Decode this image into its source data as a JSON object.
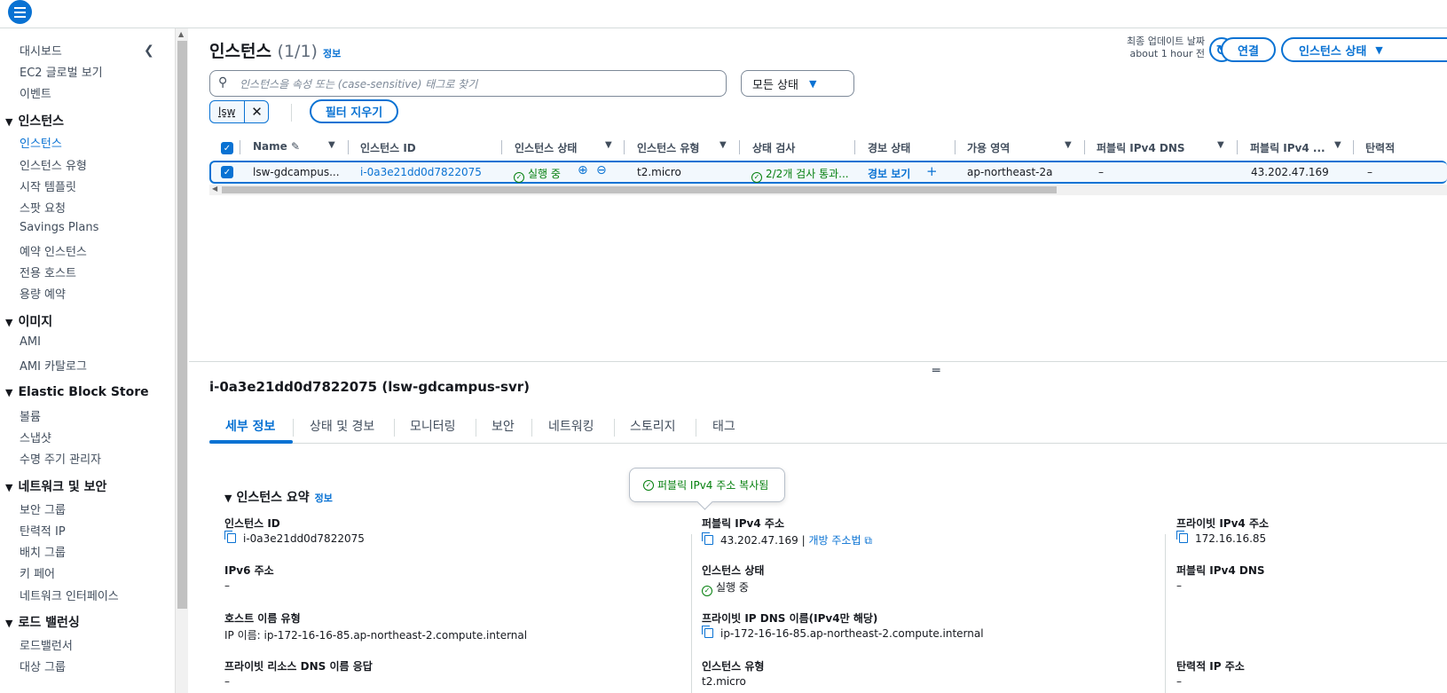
{
  "sidebar": {
    "items_top": [
      "대시보드",
      "EC2 글로벌 보기",
      "이벤트"
    ],
    "sections": [
      {
        "title": "인스턴스",
        "items": [
          "인스턴스",
          "인스턴스 유형",
          "시작 템플릿",
          "스팟 요청",
          "Savings Plans",
          "예약 인스턴스",
          "전용 호스트",
          "용량 예약"
        ]
      },
      {
        "title": "이미지",
        "items": [
          "AMI",
          "AMI 카탈로그"
        ]
      },
      {
        "title": "Elastic Block Store",
        "items": [
          "볼륨",
          "스냅샷",
          "수명 주기 관리자"
        ]
      },
      {
        "title": "네트워크 및 보안",
        "items": [
          "보안 그룹",
          "탄력적 IP",
          "배치 그룹",
          "키 페어",
          "네트워크 인터페이스"
        ]
      },
      {
        "title": "로드 밸런싱",
        "items": [
          "로드밸런서",
          "대상 그룹"
        ]
      }
    ],
    "active_item": "인스턴스"
  },
  "header": {
    "title": "인스턴스",
    "count": "(1/1)",
    "info": "정보",
    "updated_label": "최종 업데이트 날짜",
    "updated_value": "about 1 hour 전",
    "connect_label": "연결",
    "state_label": "인스턴스 상태"
  },
  "search": {
    "placeholder": "인스턴스을 속성 또는 (case-sensitive) 태그로 찾기"
  },
  "state_filter": {
    "selected": "모든 상태"
  },
  "token": {
    "label": "lsw"
  },
  "clear_filters_label": "필터 지우기",
  "table": {
    "columns": [
      "Name",
      "인스턴스 ID",
      "인스턴스 상태",
      "인스턴스 유형",
      "상태 검사",
      "경보 상태",
      "가용 영역",
      "퍼블릭 IPv4 DNS",
      "퍼블릭 IPv4 ...",
      "탄력적"
    ],
    "row": {
      "name": "lsw-gdcampus...",
      "instance_id": "i-0a3e21dd0d7822075",
      "state": "실행 중",
      "type": "t2.micro",
      "status_check": "2/2개 검사 통과...",
      "alarm": "경보 보기",
      "az": "ap-northeast-2a",
      "public_dns": "–",
      "public_ip": "43.202.47.169",
      "elastic": "–"
    }
  },
  "detail": {
    "title": "i-0a3e21dd0d7822075 (lsw-gdcampus-svr)",
    "tabs": [
      "세부 정보",
      "상태 및 경보",
      "모니터링",
      "보안",
      "네트워킹",
      "스토리지",
      "태그"
    ],
    "section_title": "인스턴스 요약",
    "section_info": "정보",
    "popover": "퍼블릭 IPv4 주소 복사됨",
    "fields": {
      "instance_id_label": "인스턴스 ID",
      "instance_id_value": "i-0a3e21dd0d7822075",
      "public_ipv4_label_partial": "퍼블릭 IPv4 주소",
      "public_ipv4_value": "43.202.47.169",
      "public_ipv4_sep": " | ",
      "open_address_link": "개방 주소법",
      "private_ipv4_label": "프라이빗 IPv4 주소",
      "private_ipv4_value": "172.16.16.85",
      "ipv6_label": "IPv6 주소",
      "ipv6_value": "–",
      "state_label": "인스턴스 상태",
      "state_value": "실행 중",
      "public_dns_label": "퍼블릭 IPv4 DNS",
      "public_dns_value": "–",
      "hostname_type_label": "호스트 이름 유형",
      "hostname_type_value": "IP 이름: ip-172-16-16-85.ap-northeast-2.compute.internal",
      "private_dns_label": "프라이빗 IP DNS 이름(IPv4만 해당)",
      "private_dns_value": "ip-172-16-16-85.ap-northeast-2.compute.internal",
      "private_resource_dns_label": "프라이빗 리소스 DNS 이름 응답",
      "private_resource_dns_value": "–",
      "instance_type_label": "인스턴스 유형",
      "instance_type_value": "t2.micro",
      "elastic_ip_label": "탄력적 IP 주소",
      "elastic_ip_value": "–"
    }
  },
  "colors": {
    "accent": "#0972d3",
    "success": "#037f0c"
  }
}
